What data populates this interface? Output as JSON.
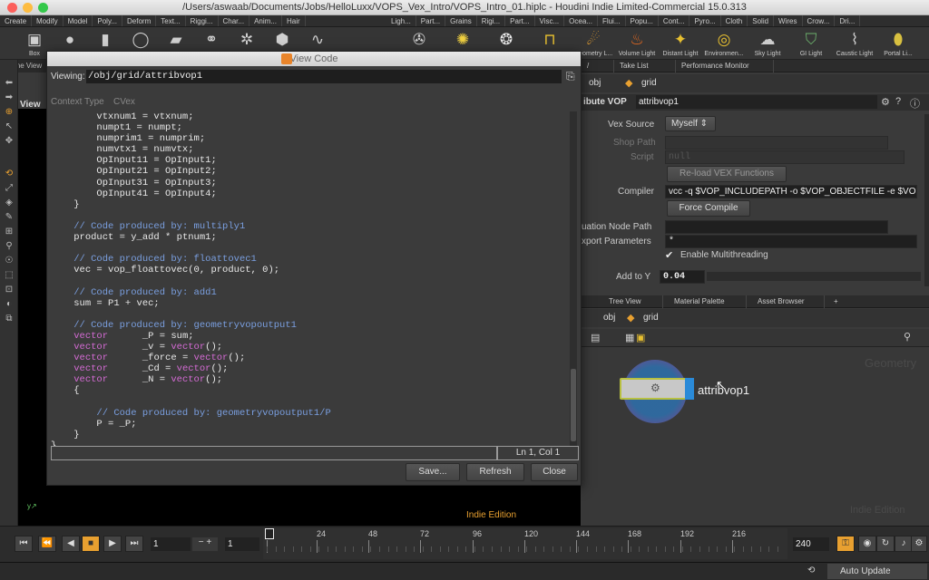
{
  "window": {
    "title": "/Users/aswaab/Documents/Jobs/HelloLuxx/VOPS_Vex_Intro/VOPS_Intro_01.hiplc - Houdini Indie Limited-Commercial 15.0.313"
  },
  "menubar": {
    "left_tabs": [
      "Create",
      "Modify",
      "Model",
      "Poly...",
      "Deform",
      "Text...",
      "Riggi...",
      "Char...",
      "Anim...",
      "Hair"
    ],
    "right_tabs": [
      "Ligh...",
      "Part...",
      "Grains",
      "Rigi...",
      "Part...",
      "Visc...",
      "Ocea...",
      "Flui...",
      "Popu...",
      "Cont...",
      "Pyro...",
      "Cloth",
      "Solid",
      "Wires",
      "Crow...",
      "Dri..."
    ]
  },
  "shelf": {
    "left_items": [
      {
        "label": "Box",
        "icon": "box-icon"
      },
      {
        "label": "",
        "icon": "sphere-icon"
      },
      {
        "label": "",
        "icon": "tube-icon"
      },
      {
        "label": "",
        "icon": "torus-icon"
      },
      {
        "label": "",
        "icon": "grid-icon"
      },
      {
        "label": "",
        "icon": "metaball-icon"
      },
      {
        "label": "",
        "icon": "lsystem-icon"
      },
      {
        "label": "",
        "icon": "platonic-icon"
      },
      {
        "label": "",
        "icon": "curve-icon"
      }
    ],
    "right_items": [
      {
        "label": "",
        "icon": "camera-icon"
      },
      {
        "label": "",
        "icon": "point-light-icon"
      },
      {
        "label": "",
        "icon": "spot-light-icon"
      },
      {
        "label": "",
        "icon": "area-light-icon"
      },
      {
        "label": "Geometry L...",
        "icon": "geometry-light-icon"
      },
      {
        "label": "Volume Light",
        "icon": "volume-light-icon"
      },
      {
        "label": "Distant Light",
        "icon": "distant-light-icon"
      },
      {
        "label": "Environmen...",
        "icon": "environment-light-icon"
      },
      {
        "label": "Sky Light",
        "icon": "sky-light-icon"
      },
      {
        "label": "GI Light",
        "icon": "gi-light-icon"
      },
      {
        "label": "Caustic Light",
        "icon": "caustic-light-icon"
      },
      {
        "label": "Portal Li...",
        "icon": "portal-light-icon"
      }
    ]
  },
  "scene_view_tab": "Scene View",
  "viewport": {
    "view_label": "View",
    "edition": "Indie Edition"
  },
  "dialog": {
    "title": "View Code",
    "viewing_label": "Viewing:",
    "viewing_path": "/obj/grid/attribvop1",
    "context_type_label": "Context Type",
    "context_type_value": "CVex",
    "status": "Ln 1, Col 1",
    "buttons": {
      "save": "Save...",
      "refresh": "Refresh",
      "close": "Close"
    },
    "code_lines": [
      {
        "indent": "        ",
        "parts": [
          {
            "t": "tx",
            "v": "vtxnum1 = vtxnum;"
          }
        ]
      },
      {
        "indent": "        ",
        "parts": [
          {
            "t": "tx",
            "v": "numpt1 = numpt;"
          }
        ]
      },
      {
        "indent": "        ",
        "parts": [
          {
            "t": "tx",
            "v": "numprim1 = numprim;"
          }
        ]
      },
      {
        "indent": "        ",
        "parts": [
          {
            "t": "tx",
            "v": "numvtx1 = numvtx;"
          }
        ]
      },
      {
        "indent": "        ",
        "parts": [
          {
            "t": "tx",
            "v": "OpInput11 = OpInput1;"
          }
        ]
      },
      {
        "indent": "        ",
        "parts": [
          {
            "t": "tx",
            "v": "OpInput21 = OpInput2;"
          }
        ]
      },
      {
        "indent": "        ",
        "parts": [
          {
            "t": "tx",
            "v": "OpInput31 = OpInput3;"
          }
        ]
      },
      {
        "indent": "        ",
        "parts": [
          {
            "t": "tx",
            "v": "OpInput41 = OpInput4;"
          }
        ]
      },
      {
        "indent": "    ",
        "parts": [
          {
            "t": "tx",
            "v": "}"
          }
        ]
      },
      {
        "indent": "",
        "parts": []
      },
      {
        "indent": "    ",
        "parts": [
          {
            "t": "cm",
            "v": "// Code produced by: multiply1"
          }
        ]
      },
      {
        "indent": "    ",
        "parts": [
          {
            "t": "tx",
            "v": "product = y_add * ptnum1;"
          }
        ]
      },
      {
        "indent": "",
        "parts": []
      },
      {
        "indent": "    ",
        "parts": [
          {
            "t": "cm",
            "v": "// Code produced by: floattovec1"
          }
        ]
      },
      {
        "indent": "    ",
        "parts": [
          {
            "t": "tx",
            "v": "vec = vop_floattovec(0, product, 0);"
          }
        ]
      },
      {
        "indent": "",
        "parts": []
      },
      {
        "indent": "    ",
        "parts": [
          {
            "t": "cm",
            "v": "// Code produced by: add1"
          }
        ]
      },
      {
        "indent": "    ",
        "parts": [
          {
            "t": "tx",
            "v": "sum = P1 + vec;"
          }
        ]
      },
      {
        "indent": "",
        "parts": []
      },
      {
        "indent": "    ",
        "parts": [
          {
            "t": "cm",
            "v": "// Code produced by: geometryvopoutput1"
          }
        ]
      },
      {
        "indent": "    ",
        "parts": [
          {
            "t": "kw",
            "v": "vector"
          },
          {
            "t": "tx",
            "v": "      _P = sum;"
          }
        ]
      },
      {
        "indent": "    ",
        "parts": [
          {
            "t": "kw",
            "v": "vector"
          },
          {
            "t": "tx",
            "v": "      _v = "
          },
          {
            "t": "kw",
            "v": "vector"
          },
          {
            "t": "tx",
            "v": "();"
          }
        ]
      },
      {
        "indent": "    ",
        "parts": [
          {
            "t": "kw",
            "v": "vector"
          },
          {
            "t": "tx",
            "v": "      _force = "
          },
          {
            "t": "kw",
            "v": "vector"
          },
          {
            "t": "tx",
            "v": "();"
          }
        ]
      },
      {
        "indent": "    ",
        "parts": [
          {
            "t": "kw",
            "v": "vector"
          },
          {
            "t": "tx",
            "v": "      _Cd = "
          },
          {
            "t": "kw",
            "v": "vector"
          },
          {
            "t": "tx",
            "v": "();"
          }
        ]
      },
      {
        "indent": "    ",
        "parts": [
          {
            "t": "kw",
            "v": "vector"
          },
          {
            "t": "tx",
            "v": "      _N = "
          },
          {
            "t": "kw",
            "v": "vector"
          },
          {
            "t": "tx",
            "v": "();"
          }
        ]
      },
      {
        "indent": "    ",
        "parts": [
          {
            "t": "tx",
            "v": "{"
          }
        ]
      },
      {
        "indent": "",
        "parts": []
      },
      {
        "indent": "        ",
        "parts": [
          {
            "t": "cm",
            "v": "// Code produced by: geometryvopoutput1/P"
          }
        ]
      },
      {
        "indent": "        ",
        "parts": [
          {
            "t": "tx",
            "v": "P = _P;"
          }
        ]
      },
      {
        "indent": "    ",
        "parts": [
          {
            "t": "tx",
            "v": "}"
          }
        ]
      },
      {
        "indent": "",
        "parts": [
          {
            "t": "tx",
            "v": "}"
          }
        ]
      }
    ]
  },
  "params_pane": {
    "tabs": [
      "Take List",
      "Performance Monitor"
    ],
    "path": [
      "obj",
      "grid"
    ],
    "node_type": "ibute VOP",
    "node_name": "attribvop1",
    "vex_source_label": "Vex Source",
    "vex_source_value": "Myself",
    "shop_path_label": "Shop Path",
    "script_label": "Script",
    "script_value": "null",
    "reload_label": "Re-load VEX Functions",
    "compiler_label": "Compiler",
    "compiler_value": "vcc -q $VOP_INCLUDEPATH -o $VOP_OBJECTFILE -e $VO",
    "force_compile_label": "Force Compile",
    "eval_node_label": "uation Node Path",
    "export_params_label": "xport Parameters",
    "export_params_value": "*",
    "multithreading_label": "Enable Multithreading",
    "multithreading_checked": true,
    "add_to_y_label": "Add to Y",
    "add_to_y_value": "0.04"
  },
  "network_pane": {
    "tabs": [
      "Tree View",
      "Material Palette",
      "Asset Browser"
    ],
    "path": [
      "obj",
      "grid"
    ],
    "node_label": "attribvop1",
    "watermark": "Geometry",
    "edition": "Indie Edition"
  },
  "timeline": {
    "start_frame": "1",
    "current_frame": "1",
    "end_frame": "240",
    "ticks": [
      "1",
      "24",
      "48",
      "72",
      "96",
      "120",
      "144",
      "168",
      "192",
      "216"
    ],
    "step": "1"
  },
  "statusbar": {
    "auto_update": "Auto Update"
  },
  "colors": {
    "keyword": "#d46bd4",
    "comment": "#7a9fe0",
    "accent_orange": "#e8a030",
    "node_blue": "#2a8ad8"
  }
}
